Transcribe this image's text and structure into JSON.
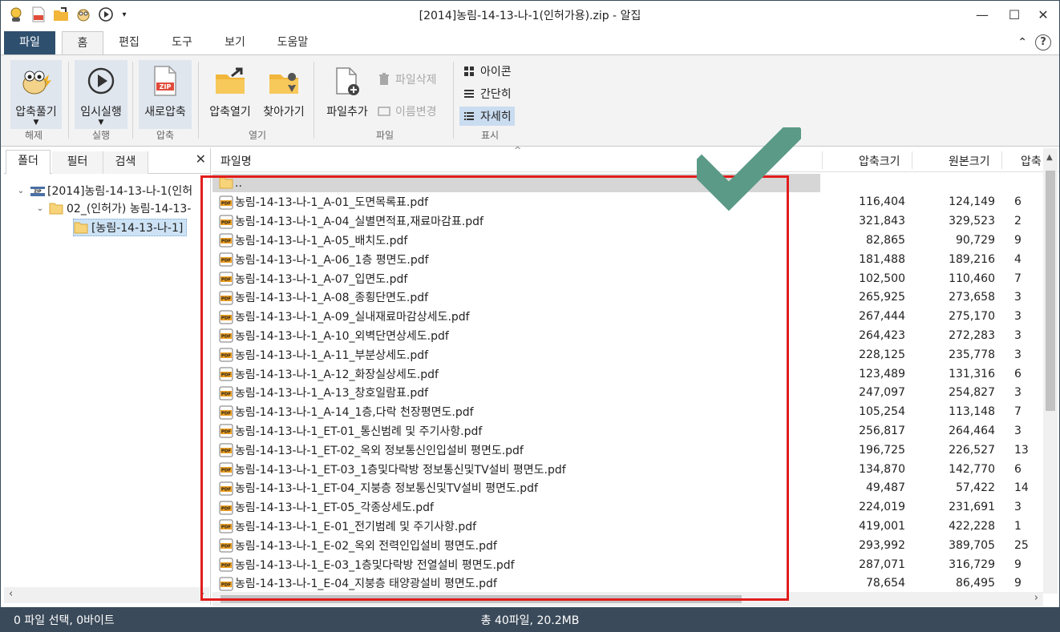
{
  "window": {
    "title": "[2014]농림-14-13-나-1(인허가용).zip - 알집",
    "minimize_label": "—",
    "maximize_label": "☐",
    "close_label": "✕"
  },
  "ribbon_tabs": [
    "파일",
    "홈",
    "편집",
    "도구",
    "보기",
    "도움말"
  ],
  "ribbon_right": {
    "collapse_label": "⌃",
    "help_label": "?"
  },
  "ribbon": {
    "groups": {
      "extract": "해제",
      "run": "실행",
      "compress": "압축",
      "open": "열기",
      "file": "파일",
      "view": "표시"
    },
    "buttons": {
      "extract": "압축풀기",
      "temp_run": "임시실행",
      "new_compress": "새로압축",
      "open_archive": "압축열기",
      "find": "찾아가기",
      "add_file": "파일추가",
      "delete_file": "파일삭제",
      "rename": "이름변경",
      "icons": "아이콘",
      "simple": "간단히",
      "detail": "자세히"
    }
  },
  "panel": {
    "tabs": [
      "폴더",
      "필터",
      "검색"
    ],
    "close_label": "✕",
    "tree": [
      {
        "label": "[2014]농림-14-13-나-1(인허",
        "level": 0
      },
      {
        "label": "02_(인허가) 농림-14-13-",
        "level": 1
      },
      {
        "label": "[농림-14-13-나-1]",
        "level": 2
      }
    ]
  },
  "list": {
    "headers": {
      "name": "파일명",
      "compressed": "압축크기",
      "original": "원본크기",
      "ratio": "압축"
    },
    "parent_label": "..",
    "rows": [
      {
        "name": "농림-14-13-나-1_A-01_도면목록표.pdf",
        "compressed": "116,404",
        "original": "124,149",
        "ratio": "6"
      },
      {
        "name": "농림-14-13-나-1_A-04_실별면적표,재료마감표.pdf",
        "compressed": "321,843",
        "original": "329,523",
        "ratio": "2"
      },
      {
        "name": "농림-14-13-나-1_A-05_배치도.pdf",
        "compressed": "82,865",
        "original": "90,729",
        "ratio": "9"
      },
      {
        "name": "농림-14-13-나-1_A-06_1층 평면도.pdf",
        "compressed": "181,488",
        "original": "189,216",
        "ratio": "4"
      },
      {
        "name": "농림-14-13-나-1_A-07_입면도.pdf",
        "compressed": "102,500",
        "original": "110,460",
        "ratio": "7"
      },
      {
        "name": "농림-14-13-나-1_A-08_종횡단면도.pdf",
        "compressed": "265,925",
        "original": "273,658",
        "ratio": "3"
      },
      {
        "name": "농림-14-13-나-1_A-09_실내재료마감상세도.pdf",
        "compressed": "267,444",
        "original": "275,170",
        "ratio": "3"
      },
      {
        "name": "농림-14-13-나-1_A-10_외벽단면상세도.pdf",
        "compressed": "264,423",
        "original": "272,283",
        "ratio": "3"
      },
      {
        "name": "농림-14-13-나-1_A-11_부분상세도.pdf",
        "compressed": "228,125",
        "original": "235,778",
        "ratio": "3"
      },
      {
        "name": "농림-14-13-나-1_A-12_화장실상세도.pdf",
        "compressed": "123,489",
        "original": "131,316",
        "ratio": "6"
      },
      {
        "name": "농림-14-13-나-1_A-13_창호일람표.pdf",
        "compressed": "247,097",
        "original": "254,827",
        "ratio": "3"
      },
      {
        "name": "농림-14-13-나-1_A-14_1층,다락 천장평면도.pdf",
        "compressed": "105,254",
        "original": "113,148",
        "ratio": "7"
      },
      {
        "name": "농림-14-13-나-1_ET-01_통신범례 및 주기사항.pdf",
        "compressed": "256,817",
        "original": "264,464",
        "ratio": "3"
      },
      {
        "name": "농림-14-13-나-1_ET-02_옥외 정보통신인입설비 평면도.pdf",
        "compressed": "196,725",
        "original": "226,527",
        "ratio": "13"
      },
      {
        "name": "농림-14-13-나-1_ET-03_1층및다락방 정보통신및TV설비 평면도.pdf",
        "compressed": "134,870",
        "original": "142,770",
        "ratio": "6"
      },
      {
        "name": "농림-14-13-나-1_ET-04_지붕층 정보통신및TV설비 평면도.pdf",
        "compressed": "49,487",
        "original": "57,422",
        "ratio": "14"
      },
      {
        "name": "농림-14-13-나-1_ET-05_각종상세도.pdf",
        "compressed": "224,019",
        "original": "231,691",
        "ratio": "3"
      },
      {
        "name": "농림-14-13-나-1_E-01_전기범례 및 주기사항.pdf",
        "compressed": "419,001",
        "original": "422,228",
        "ratio": "1"
      },
      {
        "name": "농림-14-13-나-1_E-02_옥외 전력인입설비 평면도.pdf",
        "compressed": "293,992",
        "original": "389,705",
        "ratio": "25"
      },
      {
        "name": "농림-14-13-나-1_E-03_1층및다락방 전열설비 평면도.pdf",
        "compressed": "287,071",
        "original": "316,729",
        "ratio": "9"
      },
      {
        "name": "농림-14-13-나-1_E-04_지붕층 태양광설비 평면도.pdf",
        "compressed": "78,654",
        "original": "86,495",
        "ratio": "9"
      }
    ]
  },
  "status": {
    "selection": "0 파일 선택,  0바이트",
    "total": "총 40파일,  20.2MB"
  },
  "colors": {
    "accent": "#2f4f6e",
    "status_bar": "#3b4a5a",
    "highlight_box": "#e21d1d",
    "checkmark": "#5a9a86"
  }
}
